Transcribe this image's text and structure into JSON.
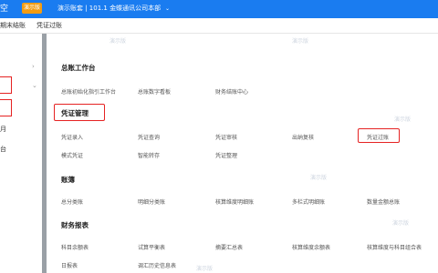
{
  "topbar": {
    "logo_fragment": "空",
    "env_badge": "演示版",
    "org_info": "演示账套 | 101.1 金蝶通讯公司本部",
    "org_caret": "⌄"
  },
  "tabs": [
    "期末结账",
    "凭证过账"
  ],
  "sidebar": {
    "chevron_right": "›",
    "chevron_down": "⌄",
    "text_1": "月",
    "text_2": "台"
  },
  "sections": {
    "gl_workbench": {
      "title": "总账工作台",
      "items": [
        "总账初始化指引工作台",
        "总账数字看板",
        "财务结账中心"
      ]
    },
    "voucher_mgmt": {
      "title": "凭证管理",
      "items": [
        "凭证录入",
        "凭证查询",
        "凭证审核",
        "出纳复核",
        "凭证过账",
        "模式凭证",
        "智能转存",
        "凭证整理"
      ]
    },
    "ledger": {
      "title": "账簿",
      "items": [
        "总分类账",
        "明细分类账",
        "核算维度明细账",
        "多栏式明细账",
        "数量金额总账"
      ]
    },
    "reports": {
      "title": "财务报表",
      "items": [
        "科目余额表",
        "试算平衡表",
        "摘要汇总表",
        "核算维度余额表",
        "核算维度与科目组合表",
        "日报表",
        "调汇历史信息表"
      ]
    }
  },
  "watermark": "演示版",
  "colors": {
    "topbar": "#1a7cf0",
    "badge": "#f39c12",
    "highlight": "#e52222"
  }
}
